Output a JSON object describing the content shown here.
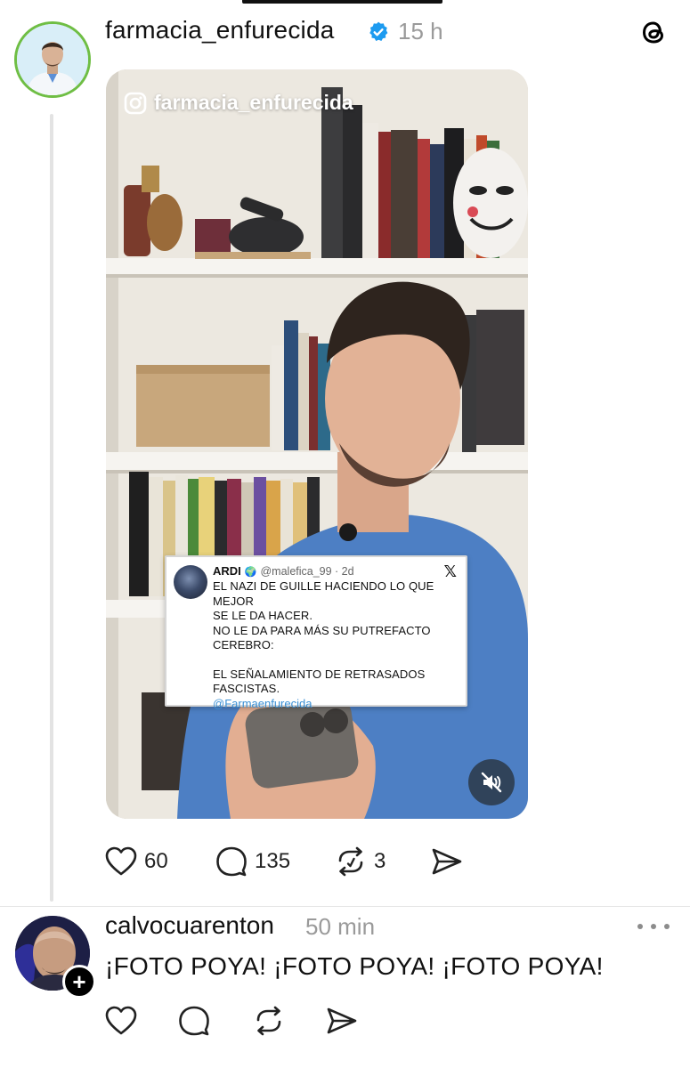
{
  "post": {
    "username": "farmacia_enfurecida",
    "time": "15 h",
    "video_watermark": "farmacia_enfurecida",
    "tweet": {
      "name": "ARDI",
      "handle": "@malefica_99 · 2d",
      "line1": "EL NAZI DE GUILLE HACIENDO LO QUE MEJOR",
      "line2": "SE LE DA HACER.",
      "line3": "NO LE DA PARA MÁS SU PUTREFACTO",
      "line4": "CEREBRO:",
      "line5": "EL SEÑALAMIENTO DE RETRASADOS",
      "line6": "FASCISTAS.",
      "mention": "@Farmaenfurecida",
      "x_glyph": "𝕏"
    },
    "stats": {
      "likes": "60",
      "replies": "135",
      "reposts": "3"
    }
  },
  "reply": {
    "username": "calvocuarenton",
    "time": "50 min",
    "text": "¡FOTO POYA! ¡FOTO POYA! ¡FOTO POYA!",
    "follow_symbol": "+"
  },
  "icons": {
    "verified": "verified-badge-icon",
    "threads": "threads-logo-icon",
    "like": "heart-icon",
    "comment": "comment-bubble-icon",
    "repost": "repost-icon",
    "share": "send-icon",
    "mute": "speaker-muted-icon",
    "more": "more-dots-icon",
    "instagram": "instagram-icon"
  },
  "colors": {
    "verified_blue": "#1d9bf0",
    "avatar_ring": "#6fbe44",
    "meta_gray": "#9a9a9a",
    "link_blue": "#3a8fd4"
  }
}
